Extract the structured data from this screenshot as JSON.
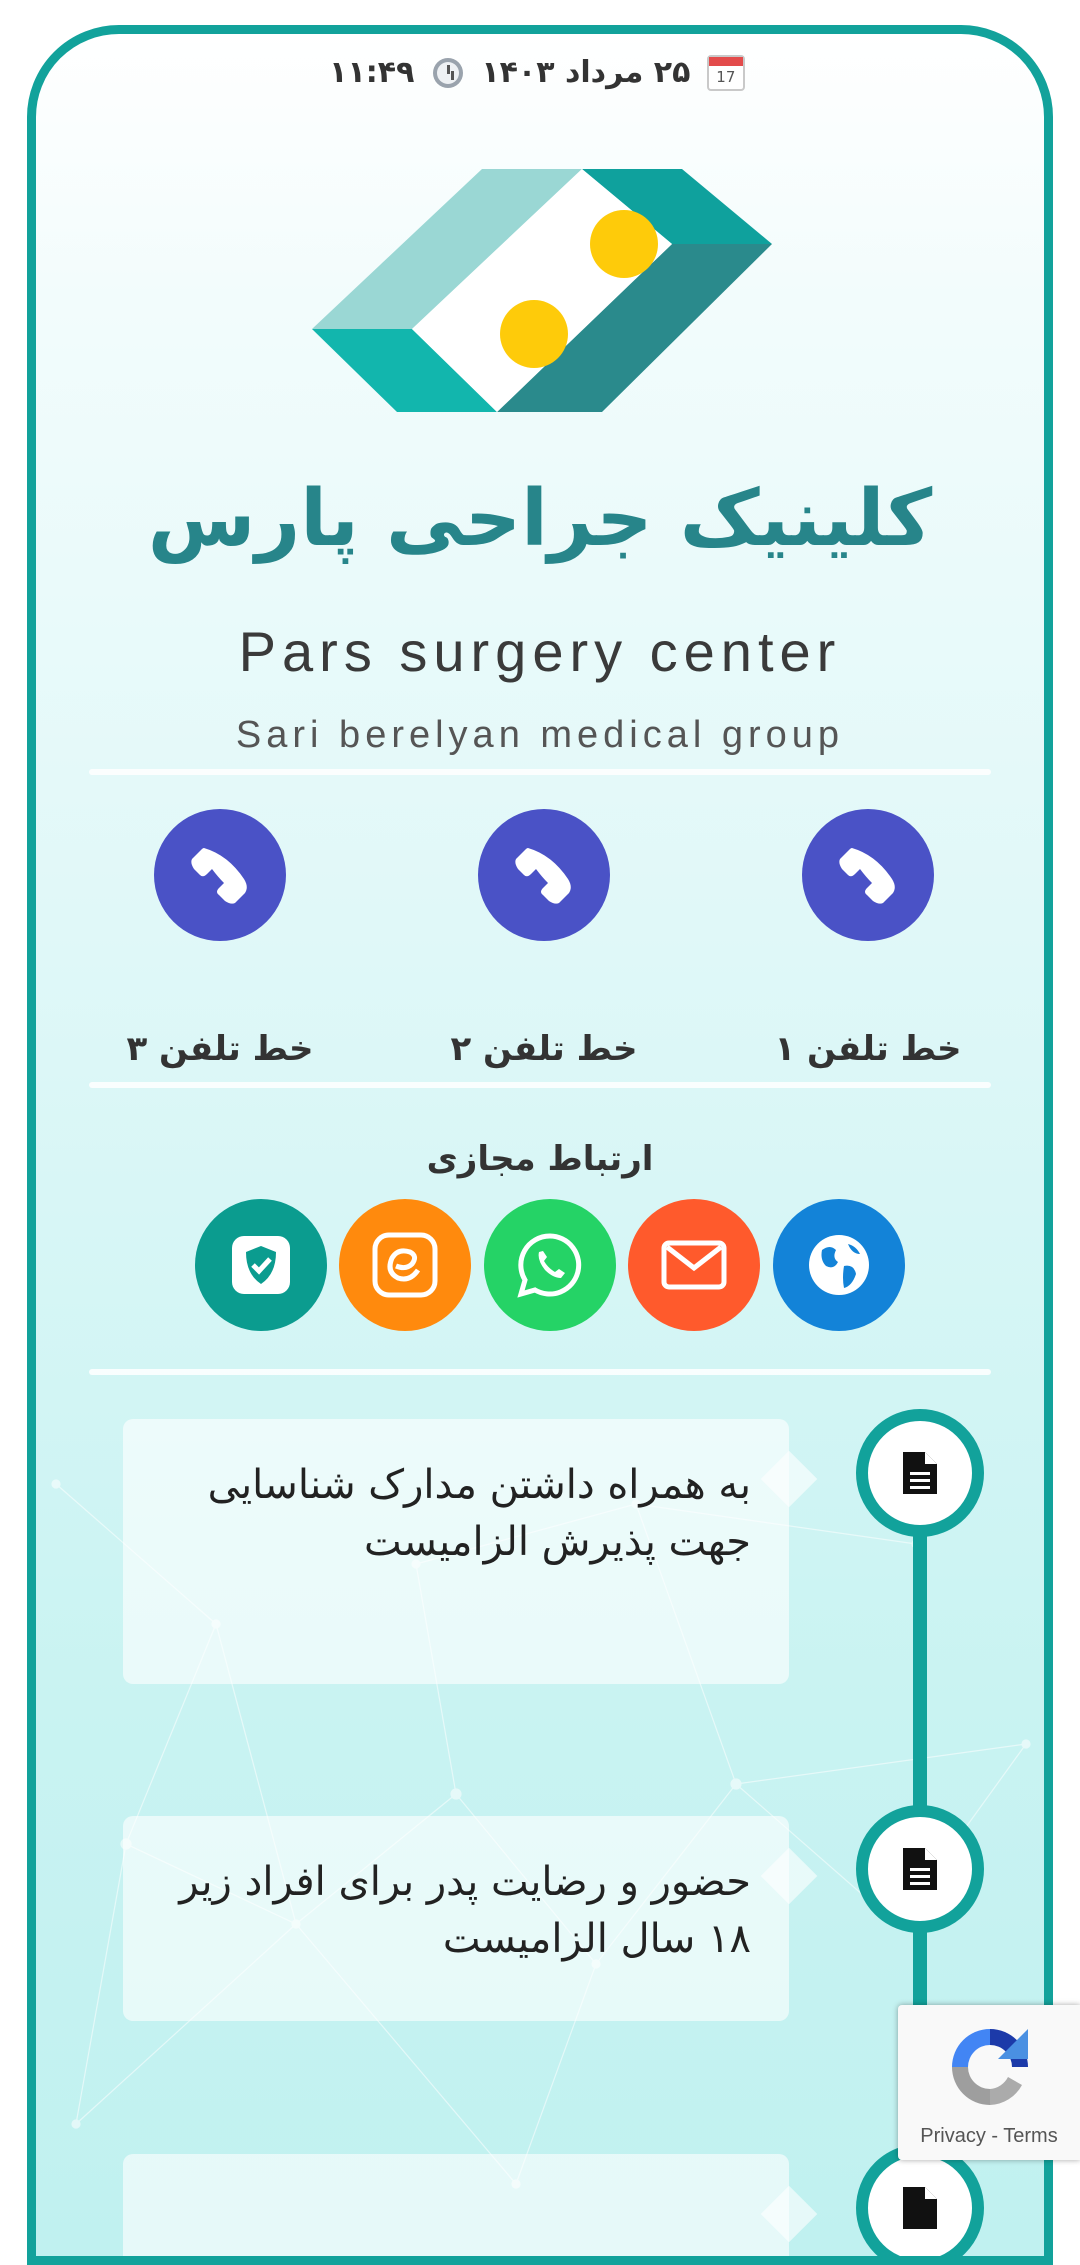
{
  "status_bar": {
    "date": "۲۵ مرداد ۱۴۰۳",
    "time": "۱۱:۴۹"
  },
  "header": {
    "title": "کلینیک جراحی پارس",
    "subtitle": "Pars surgery center",
    "tagline": "Sari berelyan medical group"
  },
  "phones": [
    {
      "label": "خط تلفن ۱",
      "icon": "phone-icon"
    },
    {
      "label": "خط تلفن ۲",
      "icon": "phone-icon"
    },
    {
      "label": "خط تلفن ۳",
      "icon": "phone-icon"
    }
  ],
  "social": {
    "title": "ارتباط مجازی",
    "items": [
      {
        "name": "website",
        "icon": "globe-icon",
        "color": "#1383d8"
      },
      {
        "name": "email",
        "icon": "envelope-icon",
        "color": "#ff5a2c"
      },
      {
        "name": "whatsapp",
        "icon": "whatsapp-icon",
        "color": "#25d366"
      },
      {
        "name": "eitaa",
        "icon": "eitaa-icon",
        "color": "#ff8a0d"
      },
      {
        "name": "bale",
        "icon": "shield-check-icon",
        "color": "#0b9c8f"
      }
    ]
  },
  "timeline": [
    {
      "text": "به همراه داشتن مدارک شناسایی جهت پذیرش الزامیست",
      "icon": "document-icon"
    },
    {
      "text": "حضور و رضایت پدر برای افراد زیر ۱۸ سال الزامیست",
      "icon": "document-icon"
    }
  ],
  "recaptcha": {
    "links": "Privacy - Terms"
  },
  "colors": {
    "frame": "#12a29b",
    "title": "#27858a",
    "phone_button": "#4a52c6"
  }
}
